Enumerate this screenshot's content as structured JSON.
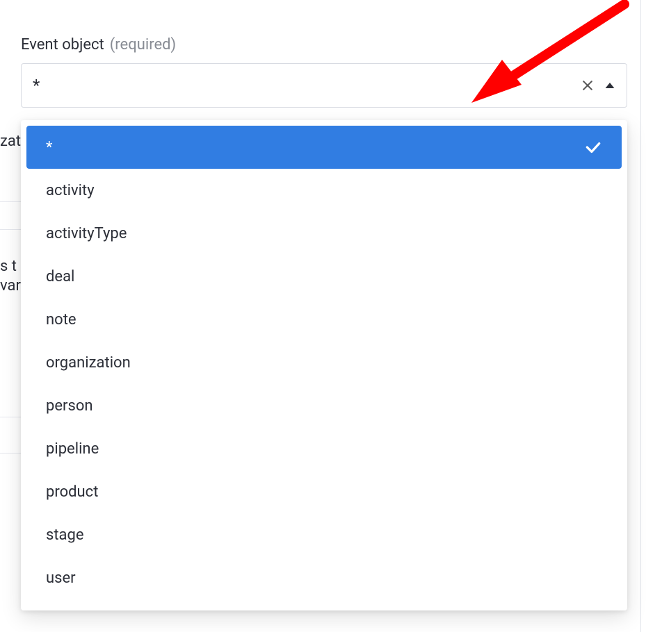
{
  "field": {
    "label": "Event object",
    "required_text": "(required)",
    "selected_value": "*"
  },
  "options": [
    {
      "label": "*",
      "selected": true
    },
    {
      "label": "activity",
      "selected": false
    },
    {
      "label": "activityType",
      "selected": false
    },
    {
      "label": "deal",
      "selected": false
    },
    {
      "label": "note",
      "selected": false
    },
    {
      "label": "organization",
      "selected": false
    },
    {
      "label": "person",
      "selected": false
    },
    {
      "label": "pipeline",
      "selected": false
    },
    {
      "label": "product",
      "selected": false
    },
    {
      "label": "stage",
      "selected": false
    },
    {
      "label": "user",
      "selected": false
    }
  ],
  "background_fragments": {
    "frag_a": "zat",
    "frag_b_line1": "s t",
    "frag_b_line2": "var"
  },
  "colors": {
    "accent": "#317de2",
    "arrow": "#ff0000"
  }
}
